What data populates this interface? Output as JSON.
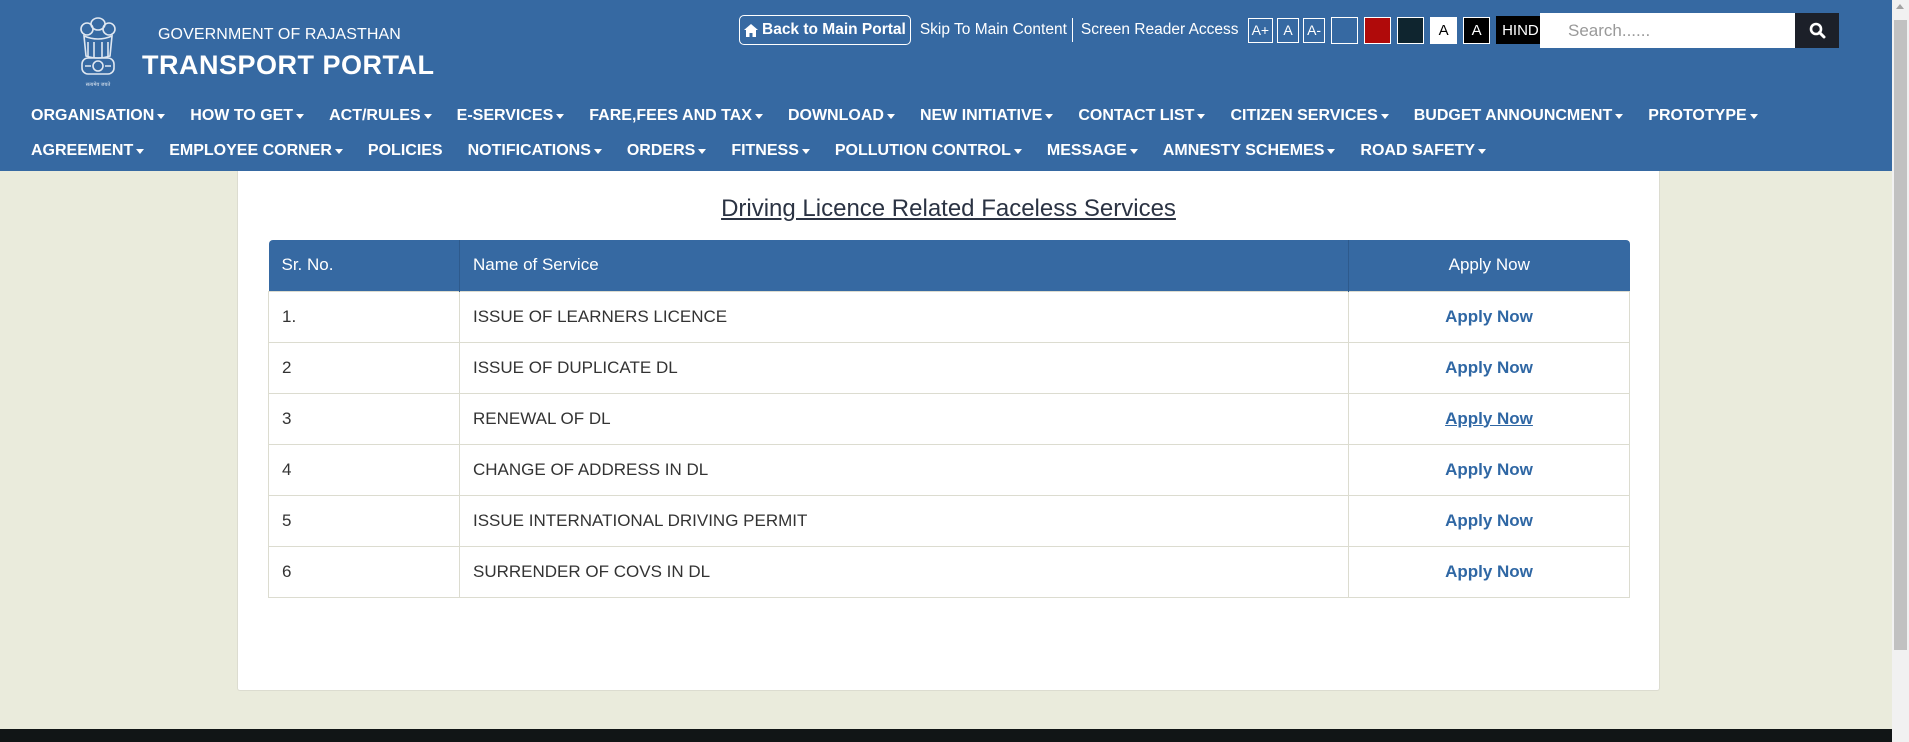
{
  "header": {
    "gov_text": "GOVERNMENT OF RAJASTHAN",
    "portal_title": "TRANSPORT PORTAL",
    "emblem_caption": "सत्यमेव जयते",
    "back_button": "Back to Main Portal",
    "skip_link": "Skip To Main Content",
    "screen_reader_link": "Screen Reader Access",
    "font_buttons": [
      "A+",
      "A",
      "A-"
    ],
    "theme_swatches": [
      {
        "name": "blue",
        "color": "#3669a2"
      },
      {
        "name": "red",
        "color": "#b00a0a"
      },
      {
        "name": "dark",
        "color": "#0f252f"
      }
    ],
    "contrast_buttons": [
      {
        "label": "A",
        "bg": "#ffffff",
        "fg": "#000000"
      },
      {
        "label": "A",
        "bg": "#000000",
        "fg": "#ffffff"
      }
    ],
    "language_button": "HINDI",
    "search": {
      "placeholder": "Search......",
      "value": ""
    }
  },
  "nav": {
    "row1": [
      {
        "label": "ORGANISATION",
        "dropdown": true
      },
      {
        "label": "HOW TO GET",
        "dropdown": true
      },
      {
        "label": "ACT/RULES",
        "dropdown": true
      },
      {
        "label": "E-SERVICES",
        "dropdown": true
      },
      {
        "label": "FARE,FEES AND TAX",
        "dropdown": true
      },
      {
        "label": "DOWNLOAD",
        "dropdown": true
      },
      {
        "label": "NEW INITIATIVE",
        "dropdown": true
      },
      {
        "label": "CONTACT LIST",
        "dropdown": true
      },
      {
        "label": "CITIZEN SERVICES",
        "dropdown": true
      },
      {
        "label": "BUDGET ANNOUNCMENT",
        "dropdown": true
      },
      {
        "label": "PROTOTYPE",
        "dropdown": true
      }
    ],
    "row2": [
      {
        "label": "AGREEMENT",
        "dropdown": true
      },
      {
        "label": "EMPLOYEE CORNER",
        "dropdown": true
      },
      {
        "label": "POLICIES",
        "dropdown": false
      },
      {
        "label": "NOTIFICATIONS",
        "dropdown": true
      },
      {
        "label": "ORDERS",
        "dropdown": true
      },
      {
        "label": "FITNESS",
        "dropdown": true
      },
      {
        "label": "POLLUTION CONTROL",
        "dropdown": true
      },
      {
        "label": "MESSAGE",
        "dropdown": true
      },
      {
        "label": "AMNESTY SCHEMES",
        "dropdown": true
      },
      {
        "label": "ROAD SAFETY",
        "dropdown": true
      }
    ]
  },
  "main": {
    "title": "Driving Licence Related Faceless Services",
    "table": {
      "headers": [
        "Sr. No.",
        "Name of Service",
        "Apply Now"
      ],
      "rows": [
        {
          "sr": "1.",
          "service": "ISSUE OF LEARNERS LICENCE",
          "action": "Apply Now",
          "hovered": false
        },
        {
          "sr": "2",
          "service": "ISSUE OF DUPLICATE DL",
          "action": "Apply Now",
          "hovered": false
        },
        {
          "sr": "3",
          "service": "RENEWAL OF DL",
          "action": "Apply Now",
          "hovered": true
        },
        {
          "sr": "4",
          "service": "CHANGE OF ADDRESS IN DL",
          "action": "Apply Now",
          "hovered": false
        },
        {
          "sr": "5",
          "service": "ISSUE INTERNATIONAL DRIVING PERMIT",
          "action": "Apply Now",
          "hovered": false
        },
        {
          "sr": "6",
          "service": "SURRENDER OF COVS IN DL",
          "action": "Apply Now",
          "hovered": false
        }
      ]
    }
  },
  "colors": {
    "brand_blue": "#3669a2",
    "link_blue": "#2f67a4",
    "page_bg": "#eaebdc",
    "footer": "#111516"
  }
}
